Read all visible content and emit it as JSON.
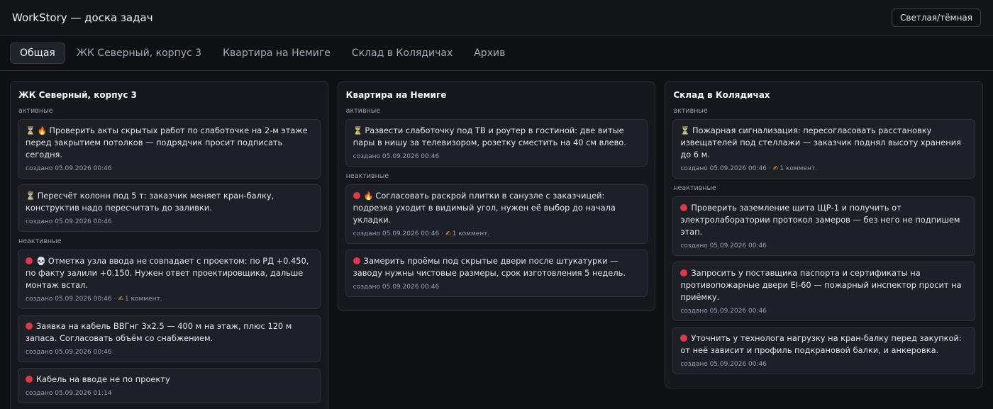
{
  "app": {
    "title": "WorkStory — доска задач",
    "theme_toggle": "Светлая/тёмная"
  },
  "tabs": [
    {
      "label": "Общая",
      "active": true
    },
    {
      "label": "ЖК Северный, корпус 3",
      "active": false
    },
    {
      "label": "Квартира на Немиге",
      "active": false
    },
    {
      "label": "Склад в Колядичах",
      "active": false
    },
    {
      "label": "Архив",
      "active": false
    }
  ],
  "columns": [
    {
      "title": "ЖК Северный, корпус 3",
      "active_label": "активные",
      "inactive_label": "неактивные",
      "active": [
        {
          "icons": [
            "hourglass-icon",
            "fire-icon"
          ],
          "text": "Проверить акты скрытых работ по слаботочке на 2-м этаже перед закрытием потолков — подрядчик просит подписать сегодня.",
          "meta": "создано 05.09.2026 00:46",
          "comments": ""
        },
        {
          "icons": [
            "hourglass-icon"
          ],
          "text": "Пересчёт колонн под 5 т: заказчик меняет кран-балку, конструктив надо пересчитать до заливки.",
          "meta": "создано 05.09.2026 00:46",
          "comments": ""
        }
      ],
      "inactive": [
        {
          "icons": [
            "red-circle-icon",
            "skull-icon"
          ],
          "text": "Отметка узла ввода не совпадает с проектом: по РД +0.450, по факту залили +0.150. Нужен ответ проектировщика, дальше монтаж встал.",
          "meta": "создано 05.09.2026 00:46",
          "comments": "1 коммент."
        },
        {
          "icons": [
            "red-circle-icon"
          ],
          "text": "Заявка на кабель ВВГнг 3х2.5 — 400 м на этаж, плюс 120 м запаса. Согласовать объём со снабжением.",
          "meta": "создано 05.09.2026 00:46",
          "comments": ""
        },
        {
          "icons": [
            "red-circle-icon"
          ],
          "text": "Кабель на вводе не по проекту",
          "meta": "создано 05.09.2026 01:14",
          "comments": ""
        }
      ]
    },
    {
      "title": "Квартира на Немиге",
      "active_label": "активные",
      "inactive_label": "неактивные",
      "active": [
        {
          "icons": [
            "hourglass-icon"
          ],
          "text": "Развести слаботочку под ТВ и роутер в гостиной: две витые пары в нишу за телевизором, розетку сместить на 40 см влево.",
          "meta": "создано 05.09.2026 00:46",
          "comments": ""
        }
      ],
      "inactive": [
        {
          "icons": [
            "red-circle-icon",
            "fire-icon"
          ],
          "text": "Согласовать раскрой плитки в санузле с заказчицей: подрезка уходит в видимый угол, нужен её выбор до начала укладки.",
          "meta": "создано 05.09.2026 00:46",
          "comments": "1 коммент."
        },
        {
          "icons": [
            "red-circle-icon"
          ],
          "text": "Замерить проёмы под скрытые двери после штукатурки — заводу нужны чистовые размеры, срок изготовления 5 недель.",
          "meta": "создано 05.09.2026 00:46",
          "comments": ""
        }
      ]
    },
    {
      "title": "Склад в Колядичах",
      "active_label": "активные",
      "inactive_label": "неактивные",
      "active": [
        {
          "icons": [
            "hourglass-icon"
          ],
          "text": "Пожарная сигнализация: пересогласовать расстановку извещателей под стеллажи — заказчик поднял высоту хранения до 6 м.",
          "meta": "создано 05.09.2026 00:46",
          "comments": "1 коммент."
        }
      ],
      "inactive": [
        {
          "icons": [
            "red-circle-icon"
          ],
          "text": "Проверить заземление щита ЩР-1 и получить от электролаборатории протокол замеров — без него не подпишем этап.",
          "meta": "создано 05.09.2026 00:46",
          "comments": ""
        },
        {
          "icons": [
            "red-circle-icon"
          ],
          "text": "Запросить у поставщика паспорта и сертификаты на противопожарные двери EI-60 — пожарный инспектор просит на приёмку.",
          "meta": "создано 05.09.2026 00:46",
          "comments": ""
        },
        {
          "icons": [
            "red-circle-icon"
          ],
          "text": "Уточнить у технолога нагрузку на кран-балку перед закупкой: от неё зависит и профиль подкрановой балки, и анкеровка.",
          "meta": "создано 05.09.2026 00:46",
          "comments": ""
        }
      ]
    }
  ]
}
